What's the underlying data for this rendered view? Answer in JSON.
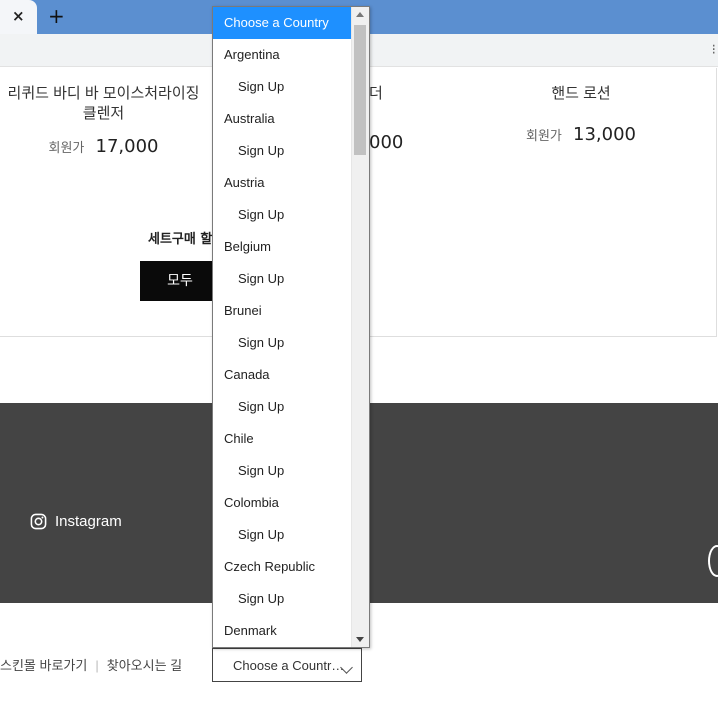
{
  "browser": {
    "close_tab_glyph": "×",
    "new_tab_glyph": "+"
  },
  "products": [
    {
      "name_line1": "리퀴드 바디 바 모이스처라이징",
      "name_line2": "클렌저",
      "price_label": "회원가",
      "price": "17,000"
    },
    {
      "name_line1": "더",
      "price_suffix": "000"
    },
    {
      "name": "핸드 로션",
      "price_label": "회원가",
      "price": "13,000"
    }
  ],
  "set_purchase": {
    "label": "세트구매 할",
    "button_label": "모두"
  },
  "footer": {
    "instagram_label": "Instagram"
  },
  "bottom_links": {
    "link1": "스킨몰 바로가기",
    "link2": "찾아오시는 길"
  },
  "country_select": {
    "value": "Choose a Countr…"
  },
  "dropdown": {
    "items": [
      {
        "label": "Choose a Country",
        "type": "header"
      },
      {
        "label": "Argentina",
        "type": "country"
      },
      {
        "label": "Sign Up",
        "type": "sub"
      },
      {
        "label": "Australia",
        "type": "country"
      },
      {
        "label": "Sign Up",
        "type": "sub"
      },
      {
        "label": "Austria",
        "type": "country"
      },
      {
        "label": "Sign Up",
        "type": "sub"
      },
      {
        "label": "Belgium",
        "type": "country"
      },
      {
        "label": "Sign Up",
        "type": "sub"
      },
      {
        "label": "Brunei",
        "type": "country"
      },
      {
        "label": "Sign Up",
        "type": "sub"
      },
      {
        "label": "Canada",
        "type": "country"
      },
      {
        "label": "Sign Up",
        "type": "sub"
      },
      {
        "label": "Chile",
        "type": "country"
      },
      {
        "label": "Sign Up",
        "type": "sub"
      },
      {
        "label": "Colombia",
        "type": "country"
      },
      {
        "label": "Sign Up",
        "type": "sub"
      },
      {
        "label": "Czech Republic",
        "type": "country"
      },
      {
        "label": "Sign Up",
        "type": "sub"
      },
      {
        "label": "Denmark",
        "type": "country"
      }
    ],
    "selected_color": "#1e90ff"
  },
  "colors": {
    "tabbar": "#5b8fd0",
    "footer": "#444444",
    "button": "#0a0a0a"
  }
}
